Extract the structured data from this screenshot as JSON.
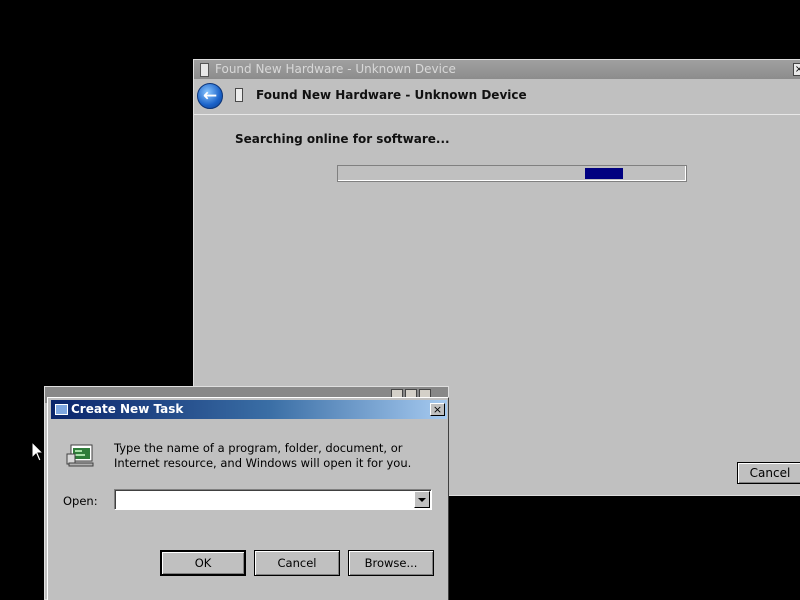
{
  "hardware_wizard": {
    "window_title": "Found New Hardware - Unknown Device",
    "header_title": "Found New Hardware - Unknown Device",
    "status_text": "Searching online for software...",
    "progress_fraction": 0.11,
    "progress_offset_fraction": 0.71,
    "cancel_label": "Cancel",
    "close_glyph": "×",
    "back_glyph": "←"
  },
  "create_task_dialog": {
    "title": "Create New Task",
    "close_glyph": "×",
    "message": "Type the name of a program, folder, document, or Internet resource, and Windows will open it for you.",
    "open_label": "Open:",
    "open_value": "",
    "buttons": {
      "ok": "OK",
      "cancel": "Cancel",
      "browse": "Browse..."
    }
  },
  "colors": {
    "desktop": "#000000",
    "window_face": "#c0c0c0",
    "progress_fill": "#000080",
    "active_title_start": "#0a246a",
    "active_title_end": "#a6caf0"
  },
  "icons": {
    "hardware": "device-icon",
    "back": "back-arrow-icon",
    "run": "run-program-icon",
    "dropdown": "chevron-down-icon",
    "cursor": "mouse-pointer-icon"
  }
}
